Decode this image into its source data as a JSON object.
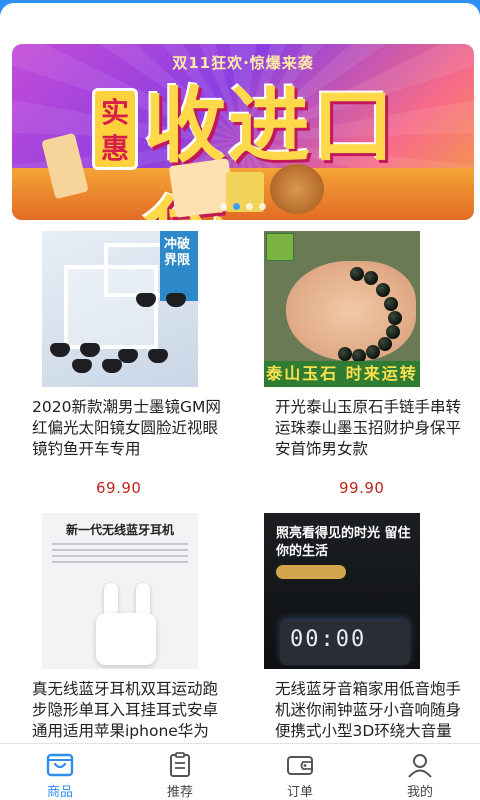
{
  "banner": {
    "topline": "双11狂欢·惊爆来袭",
    "badge": "实惠",
    "headline": "收进口袋",
    "dots": 4,
    "active_dot": 1
  },
  "products": [
    {
      "title": "2020新款潮男士墨镜GM网红偏光太阳镜女圆脸近视眼镜钓鱼开车专用",
      "price": "69.90",
      "image_text": "冲破界限"
    },
    {
      "title": "开光泰山玉原石手链手串转运珠泰山墨玉招财护身保平安首饰男女款",
      "price": "99.90",
      "image_text": "泰山玉石  时来运转"
    },
    {
      "title": "真无线蓝牙耳机双耳运动跑步隐形单耳入耳挂耳式安卓通用适用苹果iphone华为",
      "price": "",
      "image_text": "新一代无线蓝牙耳机"
    },
    {
      "title": "无线蓝牙音箱家用低音炮手机迷你闹钟蓝牙小音响随身便携式小型3D环绕大音量",
      "price": "",
      "image_text": "照亮看得见的时光 留住你的生活"
    }
  ],
  "tabbar": {
    "items": [
      {
        "label": "商品",
        "icon": "shop-bag-icon",
        "active": true
      },
      {
        "label": "推荐",
        "icon": "clipboard-icon",
        "active": false
      },
      {
        "label": "订单",
        "icon": "wallet-icon",
        "active": false
      },
      {
        "label": "我的",
        "icon": "user-icon",
        "active": false
      }
    ]
  },
  "colors": {
    "accent": "#2f8ff0",
    "price": "#c0241d"
  }
}
